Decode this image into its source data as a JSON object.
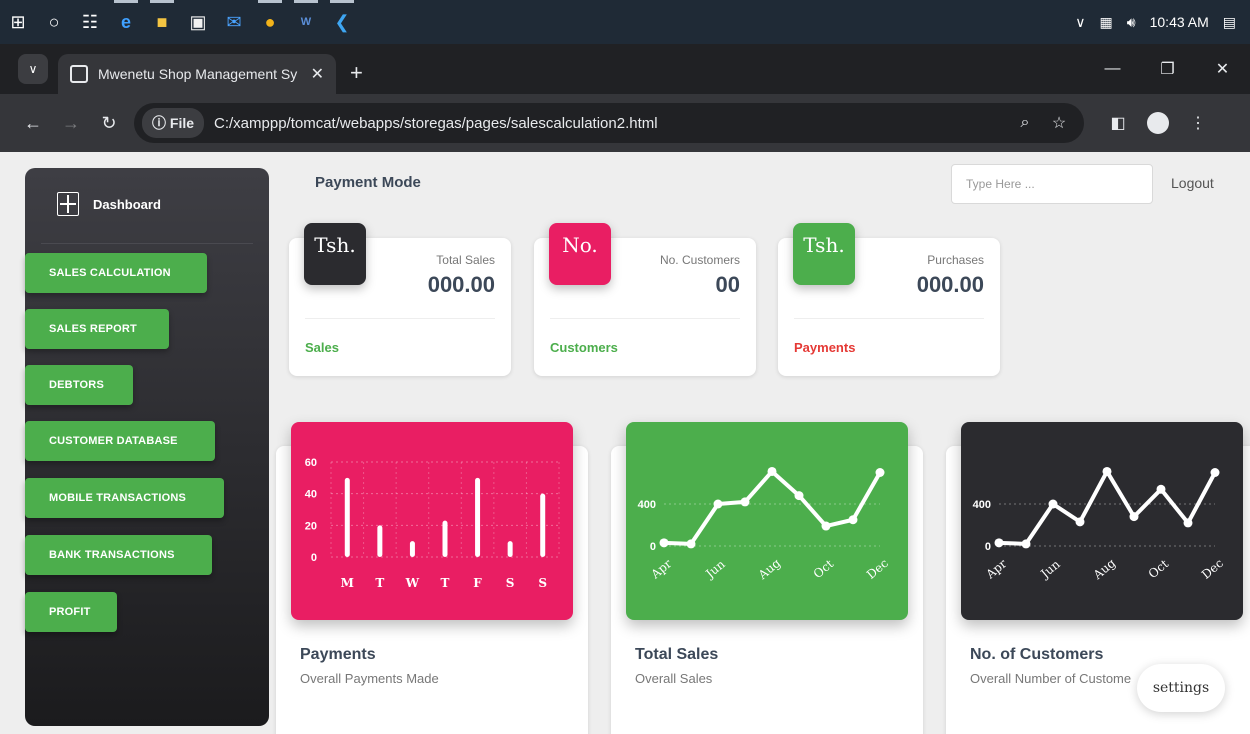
{
  "taskbar": {
    "icons": [
      "windows-start-icon",
      "search-circle-icon",
      "task-view-icon",
      "edge-icon",
      "file-explorer-icon",
      "store-icon",
      "mail-icon",
      "chrome-icon",
      "word-icon",
      "vscode-icon"
    ],
    "time": "10:43 AM"
  },
  "browser": {
    "tab_title": "Mwenetu Shop Management Sy",
    "chip_label": "File",
    "url": "C:/xamppp/tomcat/webapps/storegas/pages/salescalculation2.html"
  },
  "sidebar": {
    "brand": "Dashboard",
    "items": [
      {
        "label": "SALES CALCULATION"
      },
      {
        "label": "SALES REPORT"
      },
      {
        "label": "DEBTORS"
      },
      {
        "label": "CUSTOMER DATABASE"
      },
      {
        "label": "MOBILE TRANSACTIONS"
      },
      {
        "label": "BANK TRANSACTIONS"
      },
      {
        "label": "PROFIT"
      }
    ],
    "item_color": "#4cae4c"
  },
  "header": {
    "title": "Payment Mode",
    "search_placeholder": "Type Here ...",
    "logout": "Logout"
  },
  "stats": [
    {
      "icon_text": "Tsh.",
      "label": "Total Sales",
      "value": "000.00",
      "footer": "Sales",
      "icon_color": "#2b2b2f",
      "footer_color": "#4cae4c"
    },
    {
      "icon_text": "No.",
      "label": "No. Customers",
      "value": "00",
      "footer": "Customers",
      "icon_color": "#e91e63",
      "footer_color": "#4cae4c"
    },
    {
      "icon_text": "Tsh.",
      "label": "Purchases",
      "value": "000.00",
      "footer": "Payments",
      "icon_color": "#4cae4c",
      "footer_color": "#e53935"
    }
  ],
  "charts": [
    {
      "title": "Payments",
      "subtitle": "Overall Payments Made"
    },
    {
      "title": "Total Sales",
      "subtitle": "Overall Sales"
    },
    {
      "title": "No. of Customers",
      "subtitle": "Overall Number of Custome"
    }
  ],
  "chart_data": [
    {
      "type": "bar",
      "categories": [
        "M",
        "T",
        "W",
        "T",
        "F",
        "S",
        "S"
      ],
      "values": [
        50,
        20,
        10,
        23,
        50,
        10,
        40
      ],
      "ylim": [
        0,
        60
      ],
      "yticks": [
        "0",
        "20",
        "40",
        "60"
      ],
      "background": "#e91e63",
      "grid": true
    },
    {
      "type": "line",
      "x_labels": [
        "Apr",
        "",
        "Jun",
        "",
        "Aug",
        "",
        "Oct",
        "",
        "Dec"
      ],
      "values": [
        30,
        20,
        400,
        420,
        710,
        480,
        190,
        250,
        700
      ],
      "ylim": [
        0,
        800
      ],
      "yticks": [
        "0",
        "400"
      ],
      "background": "#4cae4c",
      "grid": true
    },
    {
      "type": "line",
      "x_labels": [
        "Apr",
        "",
        "Jun",
        "",
        "Aug",
        "",
        "Oct",
        "",
        "Dec"
      ],
      "values": [
        30,
        20,
        400,
        230,
        710,
        280,
        540,
        220,
        700
      ],
      "ylim": [
        0,
        800
      ],
      "yticks": [
        "0",
        "400"
      ],
      "background": "#2b2b2f",
      "grid": true
    }
  ],
  "settings_label": "settings"
}
